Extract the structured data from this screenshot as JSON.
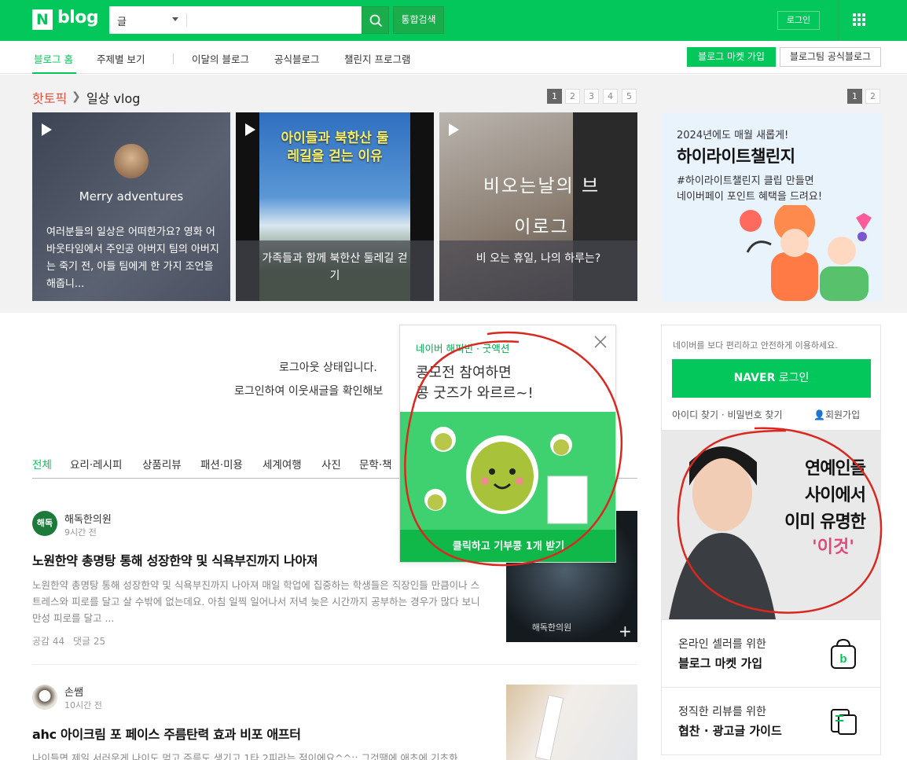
{
  "header": {
    "logo_n": "N",
    "logo_text": "blog",
    "search_category": "글",
    "search_placeholder": "",
    "unified_search": "통합검색",
    "login": "로그인"
  },
  "nav": {
    "items": [
      "블로그 홈",
      "주제별 보기",
      "이달의 블로그",
      "공식블로그",
      "챌린지 프로그램"
    ],
    "market_join": "블로그 마켓 가입",
    "official_blog": "블로그팀 공식블로그"
  },
  "hot_topic": {
    "label": "핫토픽",
    "category": "일상 vlog",
    "pages": [
      "1",
      "2",
      "3",
      "4",
      "5"
    ],
    "cards": [
      {
        "name_overlay": "Merry adventures",
        "caption": "여러분들의 일상은 어떠한가요? 영화 어바웃타임에서 주인공 아버지 팀의 아버지는 죽기 전, 아들 팀에게 한 가지 조언을 해줍니..."
      },
      {
        "overlay": "아이들과 북한산 둘레길을 걷는 이유",
        "caption": "가족들과 함께 북한산 둘레길 걷기"
      },
      {
        "overlay": "비오는날의 브이로그",
        "caption": "비 오는 휴일, 나의 하루는?"
      }
    ]
  },
  "promo": {
    "pages": [
      "1",
      "2"
    ],
    "small": "2024년에도 매월 새롭게!",
    "big": "하이라이트챌린지",
    "desc1": "#하이라이트챌린지 클립 만들면",
    "desc2": "네이버페이 포인트 혜택을 드려요!"
  },
  "main": {
    "logout_line1": "로그아웃 상태입니다.",
    "logout_line2": "로그인하여 이웃새글을 확인해보",
    "tabs": [
      "전체",
      "요리·레시피",
      "상품리뷰",
      "패션·미용",
      "세계여행",
      "사진",
      "문학·책"
    ]
  },
  "posts": [
    {
      "avatar_text": "해독",
      "author": "해독한의원",
      "time": "9시간 전",
      "title": "노원한약 총명탕 통해 성장한약 및 식욕부진까지 나아져",
      "body": "노원한약 총명탕 통해 성장한약 및 식욕부진까지 나아져 매일 학업에 집중하는 학생들은 직장인들 만큼이나 스트레스와 피로를 달고 살 수밖에 없는데요. 아침 일찍 일어나서 저녁 늦은 시간까지 공부하는 경우가 많다 보니 만성 피로를 달고 ...",
      "likes": "공감 44",
      "comments": "댓글 25",
      "thumb_text": "해독한의원"
    },
    {
      "author": "손쌤",
      "time": "10시간 전",
      "title": "ahc 아이크림 포 페이스 주름탄력 효과 비포 애프터",
      "body": "나이들면 제일 서러운게 나이도 먹고 주름도 생기고 1타 2피라는 점이에요^^;; 그것땜에 애초에 기초화"
    }
  ],
  "popup": {
    "brand": "네이버 해피빈 · 굿액션",
    "head1": "콩모전 참여하면",
    "head2": "콩 굿즈가 와르르~!",
    "cta": "클릭하고 기부콩 1개 받기"
  },
  "side": {
    "login_msg": "네이버를 보다 편리하고 안전하게 이용하세요.",
    "naver_login_brand": "NAVER",
    "naver_login_text": " 로그인",
    "find": "아이디 찾기 · 비밀번호 찾기",
    "signup": "회원가입",
    "ad_line1": "연예인들",
    "ad_line2": "사이에서",
    "ad_line3": "이미 유명한",
    "ad_line4": "'이것'",
    "box1_small": "온라인 셀러를 위한",
    "box1_big": "블로그 마켓 가입",
    "box2_small": "정직한 리뷰를 위한",
    "box2_big": "협찬 · 광고글 가이드"
  },
  "colors": {
    "brand_green": "#03c75a",
    "hot_red": "#e84e3c",
    "annotation_red": "#d9281f"
  }
}
